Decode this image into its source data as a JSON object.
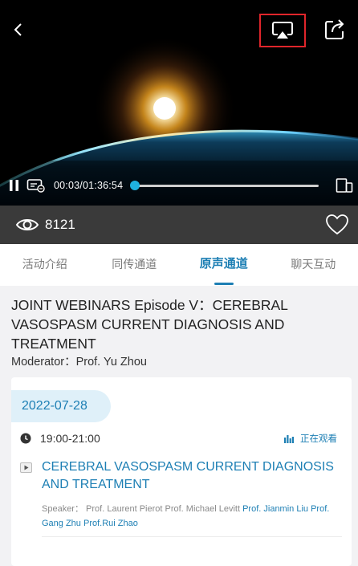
{
  "player": {
    "current_time": "00:03",
    "separator": "/",
    "duration": "01:36:54",
    "progress_fraction": 0.0006
  },
  "stats": {
    "views": "8121"
  },
  "tabs": [
    {
      "label": "活动介绍",
      "active": false
    },
    {
      "label": "同传通道",
      "active": false
    },
    {
      "label": "原声通道",
      "active": true
    },
    {
      "label": "聊天互动",
      "active": false
    }
  ],
  "event": {
    "title": "JOINT WEBINARS Episode V：CEREBRAL VASOSPASM CURRENT DIAGNOSIS AND TREATMENT",
    "moderator": "Moderator：Prof. Yu Zhou"
  },
  "session": {
    "date": "2022-07-28",
    "time_range": "19:00-21:00",
    "status": "正在观看",
    "title": "CEREBRAL VASOSPASM CURRENT DIAGNOSIS AND TREATMENT",
    "speaker_label": "Speaker：",
    "speakers_plain": "Prof. Laurent Pierot Prof. Michael Levitt",
    "speakers_highlight_1": "Prof. Jianmin Liu",
    "speakers_highlight_2": "Prof. Gang Zhu Prof.Rui Zhao"
  },
  "colors": {
    "accent": "#1d7fb4",
    "progress": "#1fb1e0",
    "highlight_box": "#e0252b",
    "views_bar": "#3a3a3a"
  },
  "icons": [
    "back-icon",
    "airplay-icon",
    "share-icon",
    "pause-icon",
    "caption-icon",
    "fullscreen-icon",
    "eye-icon",
    "heart-icon",
    "clock-icon",
    "bars-icon",
    "video-play-icon"
  ]
}
